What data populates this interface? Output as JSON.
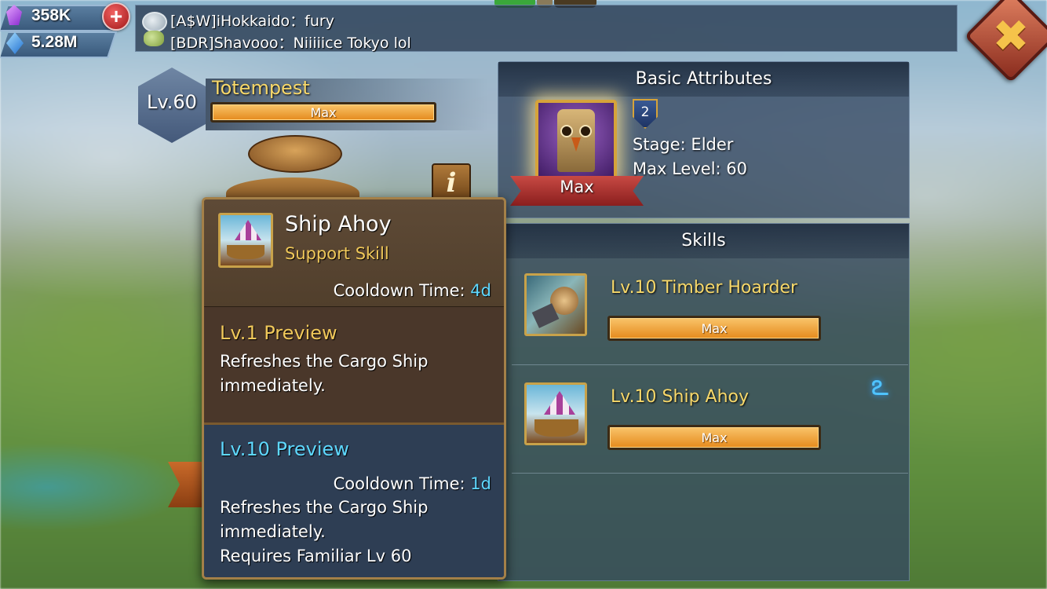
{
  "resources": {
    "gems": "358K",
    "crystals": "5.28M"
  },
  "chat": {
    "lines": [
      "[A$W]iHokkaido：fury",
      "[BDR]Shavooo：Niiiiice Tokyo lol"
    ]
  },
  "familiar": {
    "level": "Lv.60",
    "name": "Totempest",
    "progress_label": "Max",
    "progress_fraction": 1.0
  },
  "basic_attributes": {
    "title": "Basic Attributes",
    "badge": "2",
    "ribbon": "Max",
    "stage": "Stage: Elder",
    "max_level": "Max Level: 60"
  },
  "skills": {
    "title": "Skills",
    "items": [
      {
        "name": "Lv.10 Timber Hoarder",
        "bar": "Max",
        "icon": "timber-hoarder-icon"
      },
      {
        "name": "Lv.10 Ship Ahoy",
        "bar": "Max",
        "icon": "ship-ahoy-icon"
      }
    ]
  },
  "tooltip": {
    "name": "Ship Ahoy",
    "type": "Support Skill",
    "cooldown_label": "Cooldown Time: ",
    "cooldown_value": "4d",
    "lv1_title": "Lv.1 Preview",
    "lv1_desc": "Refreshes the Cargo Ship immediately.",
    "lv10_title": "Lv.10 Preview",
    "lv10_cooldown_label": "Cooldown Time: ",
    "lv10_cooldown_value": "1d",
    "lv10_desc": "Refreshes the Cargo Ship immediately.",
    "lv10_req": "Requires Familiar Lv 60"
  },
  "info_button": "i",
  "close_button": "✖",
  "colors": {
    "gold_text": "#f7d86a",
    "cyan_text": "#5ed8ff",
    "bar_fill": "#f0a640"
  }
}
